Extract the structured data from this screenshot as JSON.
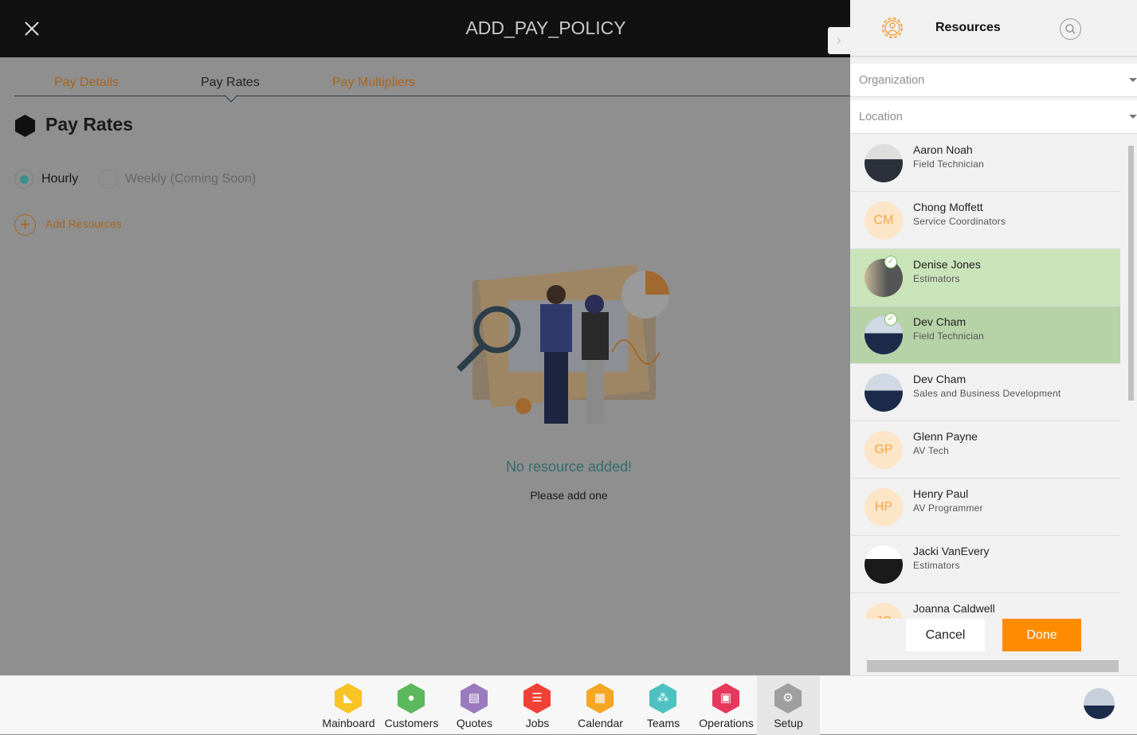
{
  "header": {
    "title": "ADD_PAY_POLICY",
    "close_icon": "close-icon"
  },
  "tabs": [
    {
      "label": "Pay Details"
    },
    {
      "label": "Pay Rates",
      "active": true
    },
    {
      "label": "Pay Multipliers"
    }
  ],
  "section": {
    "title": "Pay Rates"
  },
  "rate_type": {
    "options": [
      {
        "label": "Hourly",
        "selected": true
      },
      {
        "label": "Weekly (Coming Soon)",
        "selected": false
      }
    ]
  },
  "add_resources": "Add Resources",
  "empty": {
    "title": "No resource added!",
    "subtitle": "Please add one"
  },
  "resources": {
    "title": "Resources",
    "organization_placeholder": "Organization",
    "location_placeholder": "Location",
    "items": [
      {
        "name": "Aaron Noah",
        "role": "Field Technician",
        "selected": false
      },
      {
        "name": "Chong Moffett",
        "role": "Service Coordinators",
        "initials": "CM",
        "selected": false
      },
      {
        "name": "Denise Jones",
        "role": "Estimators",
        "selected": true
      },
      {
        "name": "Dev Cham",
        "role": "Field Technician",
        "selected": true
      },
      {
        "name": "Dev Cham",
        "role": "Sales and Business Development",
        "selected": false
      },
      {
        "name": "Glenn Payne",
        "role": "AV Tech",
        "initials": "GP",
        "selected": false
      },
      {
        "name": "Henry Paul",
        "role": "AV Programmer",
        "initials": "HP",
        "selected": false
      },
      {
        "name": "Jacki VanEvery",
        "role": "Estimators",
        "selected": false
      },
      {
        "name": "Joanna Caldwell",
        "role": "",
        "initials": "JC",
        "selected": false
      }
    ],
    "cancel": "Cancel",
    "done": "Done"
  },
  "bottom_nav": [
    {
      "label": "Mainboard",
      "color": "#f7c325"
    },
    {
      "label": "Customers",
      "color": "#5cb85c"
    },
    {
      "label": "Quotes",
      "color": "#9b7bbd"
    },
    {
      "label": "Jobs",
      "color": "#ef4136"
    },
    {
      "label": "Calendar",
      "color": "#f5a623"
    },
    {
      "label": "Teams",
      "color": "#4fc1c1"
    },
    {
      "label": "Operations",
      "color": "#e6385c"
    },
    {
      "label": "Setup",
      "color": "#9e9e9e",
      "active": true
    }
  ],
  "colors": {
    "accent": "#ff8c00",
    "selected_row": "#cae4ba"
  }
}
